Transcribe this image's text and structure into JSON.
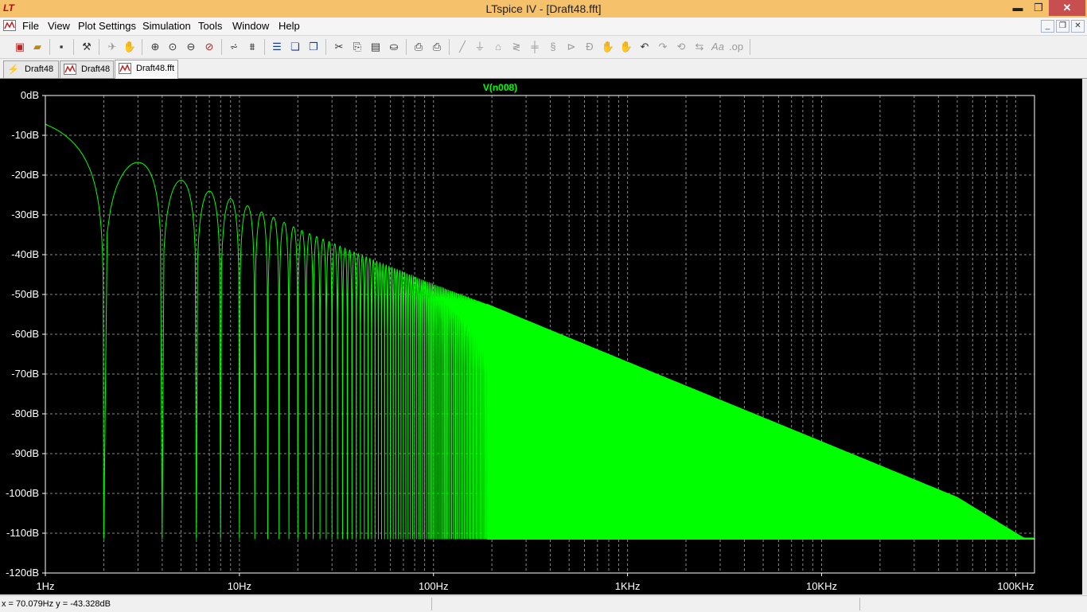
{
  "window": {
    "title": "LTspice IV - [Draft48.fft]",
    "app_icon_text": "LT",
    "minimize": "▬",
    "restore": "❐",
    "close": "✕"
  },
  "menu": [
    "File",
    "View",
    "Plot Settings",
    "Simulation",
    "Tools",
    "Window",
    "Help"
  ],
  "toolbar_icons": [
    "new-schematic-icon",
    "open-icon",
    "save-icon",
    "control-panel-icon",
    "run-icon",
    "halt-icon",
    "zoom-in-icon",
    "zoom-back-icon",
    "zoom-fit-icon",
    "zoom-cancel-icon",
    "autorange-icon",
    "delete-trace-icon",
    "tile-horizontal-icon",
    "cascade-icon",
    "tile-vertical-icon",
    "cut-icon",
    "copy-icon",
    "paste-icon",
    "find-icon",
    "print-setup-icon",
    "print-icon",
    "wire-icon",
    "ground-icon",
    "label-net-icon",
    "resistor-icon",
    "capacitor-icon",
    "inductor-icon",
    "diode-icon",
    "component-icon",
    "move-icon",
    "drag-icon",
    "undo-icon",
    "redo-icon",
    "rotate-icon",
    "mirror-icon",
    "text-icon",
    "spice-directive-icon"
  ],
  "tabs": [
    {
      "label": "Draft48",
      "icon": "schematic-icon",
      "active": false
    },
    {
      "label": "Draft48",
      "icon": "waveform-icon",
      "active": false
    },
    {
      "label": "Draft48.fft",
      "icon": "fft-waveform-icon",
      "active": true
    }
  ],
  "status": {
    "cursor_readout": "x = 70.079Hz   y = -43.328dB"
  },
  "chart_data": {
    "type": "line",
    "title": "V(n008)",
    "xlabel": "",
    "ylabel": "",
    "x_scale": "log",
    "xlim": [
      1,
      125000
    ],
    "ylim": [
      -120,
      0
    ],
    "x_ticks": [
      1,
      10,
      100,
      1000,
      10000,
      100000
    ],
    "x_tick_labels": [
      "1Hz",
      "10Hz",
      "100Hz",
      "1KHz",
      "10KHz",
      "100KHz"
    ],
    "y_ticks": [
      0,
      -10,
      -20,
      -30,
      -40,
      -50,
      -60,
      -70,
      -80,
      -90,
      -100,
      -110,
      -120
    ],
    "y_tick_labels": [
      "0dB",
      "-10dB",
      "-20dB",
      "-30dB",
      "-40dB",
      "-50dB",
      "-60dB",
      "-70dB",
      "-80dB",
      "-90dB",
      "-100dB",
      "-110dB",
      "-120dB"
    ],
    "grid": true,
    "series": [
      {
        "name": "V(n008)",
        "color": "#00ff00",
        "description_points": {
          "x": [
            1,
            1.5,
            2,
            3,
            4,
            5,
            6,
            7,
            8,
            9,
            10,
            12,
            15,
            20,
            30,
            50,
            70,
            100,
            190,
            1000,
            10000,
            50000,
            110000,
            125000
          ],
          "y": [
            -7.2,
            -14,
            -111.5,
            -16.8,
            -111.5,
            -21.3,
            -111.5,
            -24,
            -111.5,
            -25.9,
            -111.5,
            -28.7,
            -30.6,
            -33.5,
            -37,
            -41.5,
            -44.4,
            -47.5,
            -52.5,
            -67,
            -87,
            -101,
            -111.2,
            -111.5
          ]
        },
        "floor_db": -111.5,
        "peak_envelope": {
          "x": [
            3,
            5,
            7,
            9,
            11,
            15,
            20,
            30,
            50,
            70,
            100,
            190,
            1000,
            10000,
            50000,
            110000
          ],
          "y": [
            -16.8,
            -21.3,
            -24,
            -25.9,
            -27.7,
            -30.6,
            -33.5,
            -37,
            -41.5,
            -44.4,
            -47.5,
            -52.5,
            -67,
            -87,
            -101,
            -111.2
          ]
        },
        "null_frequencies_hz_start": 2,
        "null_spacing_hz": 2,
        "dense_fill_from_hz": 190
      }
    ]
  }
}
